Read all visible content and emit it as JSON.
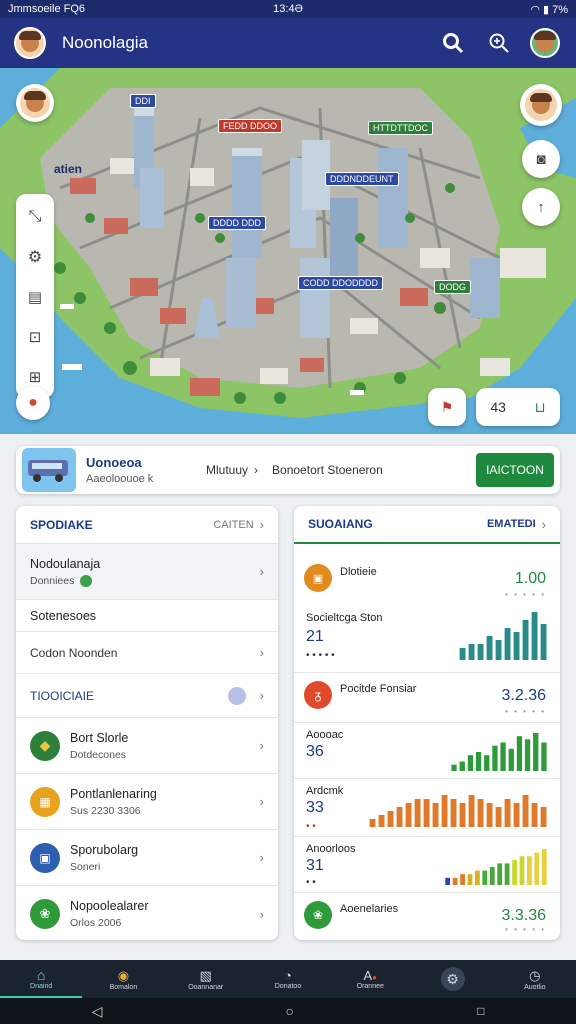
{
  "status_bar": {
    "left": "Jmmsoeile  FQ6",
    "time": "13:4Ə",
    "right": "7%"
  },
  "app_bar": {
    "title": "Noonolagia"
  },
  "map": {
    "side_label": "atien",
    "labels": [
      {
        "text": "DDI",
        "color": "blue"
      },
      {
        "text": "FEDD DDOO",
        "color": "red"
      },
      {
        "text": "HTTDTTDOC",
        "color": "green"
      },
      {
        "text": "DDDNDDEUNT",
        "color": "blue"
      },
      {
        "text": "DDDD DDD",
        "color": "blue"
      },
      {
        "text": "CODD DDODDDD",
        "color": "blue"
      },
      {
        "text": "DODG",
        "color": "green"
      }
    ],
    "chip_value": "43"
  },
  "route": {
    "title": "Uonoeoa",
    "subtitle": "Aaeoloouoe k",
    "middle": "Mlutuuy",
    "destination": "Bonoetort Stoeneron",
    "action": "IAICTOON"
  },
  "left_panel": {
    "header": "SPODIAKE",
    "header_more": "CAITEN",
    "rows": [
      {
        "title": "Nodoulanaja",
        "subtitle": "Donniees"
      },
      {
        "title": "Sotenesoes"
      },
      {
        "title": "Codon Noonden"
      }
    ],
    "section": "TIOOICIAIE",
    "items": [
      {
        "title": "Bort Slorle",
        "subtitle": "Dotdecones"
      },
      {
        "title": "Pontlanlenaring",
        "subtitle": "Sus 2230 3306"
      },
      {
        "title": "Sporubolarg",
        "subtitle": "Soneri"
      },
      {
        "title": "Nopoolealarer",
        "subtitle": "Orlos 2006"
      }
    ]
  },
  "right_panel": {
    "header": "SUOAIANG",
    "header_more": "EMATEDI",
    "rows": [
      {
        "label": "Dlotieie",
        "value": "1.00"
      },
      {
        "label": "Socieltcga Ston",
        "value": "21"
      },
      {
        "label": "Pocitde Fonsiar",
        "value": "3.2.36"
      },
      {
        "label": "Aoooac",
        "value": "36"
      },
      {
        "label": "Ardcmk",
        "value": "33"
      },
      {
        "label": "Anoorloos",
        "value": "31"
      },
      {
        "label": "Aoenelaries",
        "value": "3.3.36"
      }
    ],
    "chart_data": [
      {
        "type": "bar",
        "values": [
          3,
          4,
          4,
          6,
          5,
          8,
          7,
          10,
          12,
          9
        ],
        "color": "#2a8a8a"
      },
      {
        "type": "bar",
        "values": [
          2,
          3,
          5,
          6,
          5,
          8,
          9,
          7,
          11,
          10,
          12,
          9
        ],
        "color": "#2f9a3a"
      },
      {
        "type": "bar",
        "values": [
          2,
          3,
          4,
          5,
          6,
          7,
          7,
          6,
          8,
          7,
          6,
          8,
          7,
          6,
          5,
          7,
          6,
          8,
          6,
          5
        ],
        "color": "#e07a2a"
      },
      {
        "type": "bar",
        "values": [
          2,
          2,
          3,
          3,
          4,
          4,
          5,
          6,
          6,
          7,
          8,
          8,
          9,
          10
        ],
        "colors": [
          "#2d4aa0",
          "#e07a2a",
          "#e07a2a",
          "#d8b020",
          "#d8b020",
          "#4aa83a",
          "#4aa83a",
          "#4aa83a",
          "#4aa83a",
          "#c8d830",
          "#c8d830",
          "#e8d040",
          "#e8d040",
          "#e8d040"
        ]
      }
    ]
  },
  "bottom_nav": [
    {
      "label": "Dnaind"
    },
    {
      "label": "Bomalon"
    },
    {
      "label": "Ooannanar"
    },
    {
      "label": "Donatoo"
    },
    {
      "label": "Orannee"
    },
    {
      "label": ""
    },
    {
      "label": "Auotlio"
    }
  ]
}
